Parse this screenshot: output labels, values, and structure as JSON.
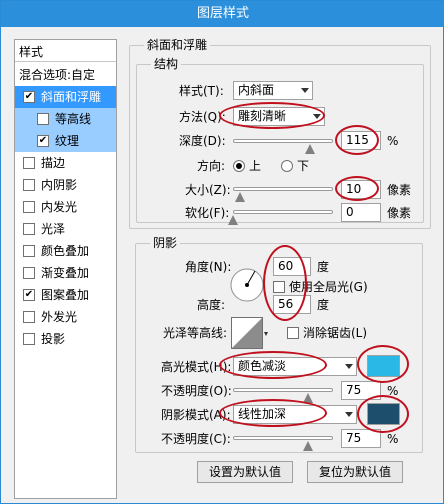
{
  "window": {
    "title": "图层样式"
  },
  "sidebar": {
    "title": "样式",
    "blend_options": "混合选项:自定",
    "items": [
      {
        "label": "斜面和浮雕",
        "checked": true
      },
      {
        "label": "等高线",
        "checked": false
      },
      {
        "label": "纹理",
        "checked": true
      },
      {
        "label": "描边",
        "checked": false
      },
      {
        "label": "内阴影",
        "checked": false
      },
      {
        "label": "内发光",
        "checked": false
      },
      {
        "label": "光泽",
        "checked": false
      },
      {
        "label": "颜色叠加",
        "checked": false
      },
      {
        "label": "渐变叠加",
        "checked": false
      },
      {
        "label": "图案叠加",
        "checked": true
      },
      {
        "label": "外发光",
        "checked": false
      },
      {
        "label": "投影",
        "checked": false
      }
    ]
  },
  "bevel": {
    "group_title": "斜面和浮雕",
    "structure_title": "结构",
    "style_label": "样式(T):",
    "style_value": "内斜面",
    "technique_label": "方法(Q):",
    "technique_value": "雕刻清晰",
    "depth_label": "深度(D):",
    "depth_value": "115",
    "depth_unit": "%",
    "depth_level": 0.77,
    "direction_label": "方向:",
    "direction_up": "上",
    "direction_down": "下",
    "size_label": "大小(Z):",
    "size_value": "10",
    "size_unit": "像素",
    "size_level": 0.07,
    "soften_label": "软化(F):",
    "soften_value": "0",
    "soften_unit": "像素",
    "soften_level": 0
  },
  "shading": {
    "title": "阴影",
    "angle_label": "角度(N):",
    "angle_value": "60",
    "angle_unit": "度",
    "global_light_label": "使用全局光(G)",
    "altitude_label": "高度:",
    "altitude_value": "56",
    "altitude_unit": "度",
    "gloss_label": "光泽等高线:",
    "antialias_label": "消除锯齿(L)",
    "highlight_label": "高光模式(H):",
    "highlight_mode": "颜色减淡",
    "highlight_color": "#2ab8e6",
    "highlight_opacity_label": "不透明度(O):",
    "highlight_opacity": "75",
    "highlight_opacity_level": 0.75,
    "shadow_label": "阴影模式(A):",
    "shadow_mode": "线性加深",
    "shadow_color": "#1d4e6b",
    "shadow_opacity_label": "不透明度(C):",
    "shadow_opacity": "75",
    "shadow_opacity_level": 0.75,
    "pct": "%"
  },
  "buttons": {
    "set_default": "设置为默认值",
    "reset_default": "复位为默认值"
  }
}
